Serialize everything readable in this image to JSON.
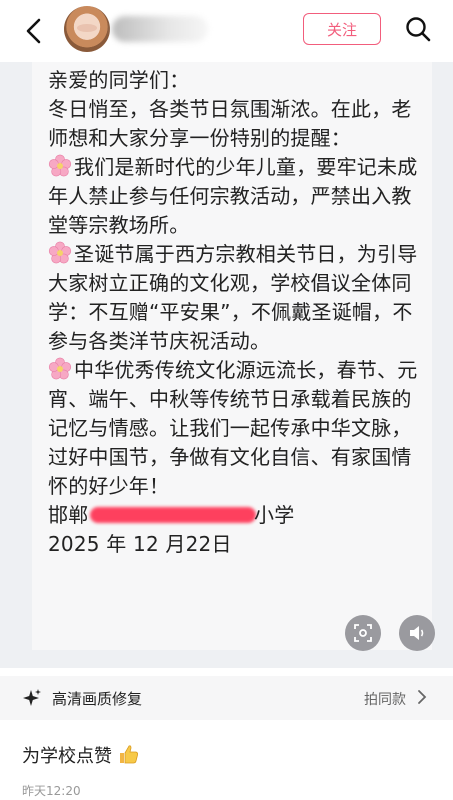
{
  "header": {
    "follow_label": "关注",
    "icons": {
      "back": "chevron-left-icon",
      "search": "search-icon",
      "avatar": "avatar"
    }
  },
  "letter": {
    "greeting": "亲爱的同学们：",
    "intro": "冬日悄至，各类节日氛围渐浓。在此，老师想和大家分享一份特别的提醒：",
    "point1": "我们是新时代的少年儿童，要牢记未成年人禁止参与任何宗教活动，严禁出入教堂等宗教场所。",
    "point2": "圣诞节属于西方宗教相关节日，为引导大家树立正确的文化观，学校倡议全体同学：不互赠“平安果”，不佩戴圣诞帽，不参与各类洋节庆祝活动。",
    "point3": "中华优秀传统文化源远流长，春节、元宵、端午、中秋等传统节日承载着民族的记忆与情感。让我们一起传承中华文脉，过好中国节，争做有文化自信、有家国情怀的好少年！",
    "school_prefix": "邯郸",
    "school_suffix": "小学",
    "date": "2025 年 12 月22日"
  },
  "enhance_bar": {
    "label": "高清画质修复",
    "same_style": "拍同款"
  },
  "post": {
    "caption": "为学校点赞",
    "time": "昨天12:20"
  },
  "colors": {
    "accent": "#f25d7c",
    "redaction": "#ff2d4e"
  }
}
